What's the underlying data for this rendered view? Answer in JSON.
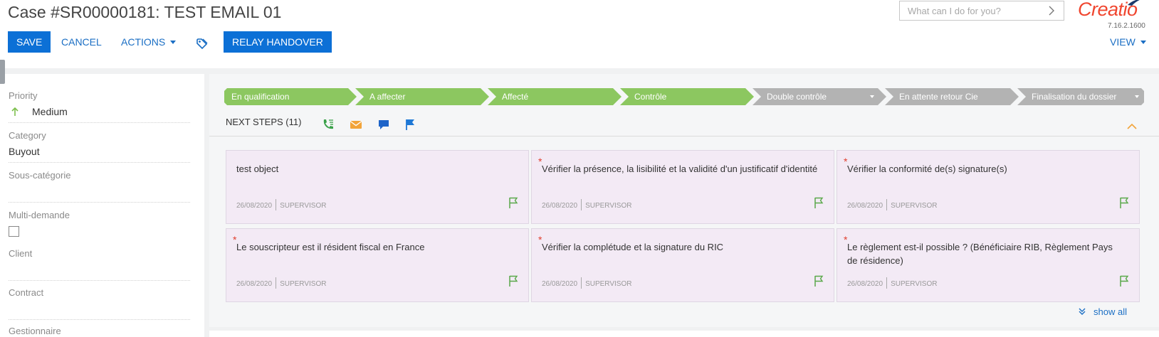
{
  "header": {
    "title": "Case #SR00000181: TEST EMAIL 01",
    "search_placeholder": "What can I do for you?",
    "logo": "Creatio",
    "version": "7.16.2.1600"
  },
  "toolbar": {
    "save": "SAVE",
    "cancel": "CANCEL",
    "actions": "ACTIONS",
    "relay": "RELAY HANDOVER",
    "view": "VIEW"
  },
  "fields": {
    "priority": {
      "label": "Priority",
      "value": "Medium"
    },
    "category": {
      "label": "Category",
      "value": "Buyout"
    },
    "subcategory": {
      "label": "Sous-catégorie",
      "value": ""
    },
    "multi": {
      "label": "Multi-demande",
      "checked": false
    },
    "client": {
      "label": "Client",
      "value": ""
    },
    "contract": {
      "label": "Contract",
      "value": ""
    },
    "gestionnaire": {
      "label": "Gestionnaire",
      "value": ""
    }
  },
  "stages": [
    {
      "label": "En qualification",
      "state": "done"
    },
    {
      "label": "A affecter",
      "state": "done"
    },
    {
      "label": "Affecté",
      "state": "done"
    },
    {
      "label": "Contrôle",
      "state": "done"
    },
    {
      "label": "Double contrôle",
      "state": "pending",
      "dropdown": true
    },
    {
      "label": "En attente retour Cie",
      "state": "pending"
    },
    {
      "label": "Finalisation du dossier",
      "state": "pending",
      "dropdown": true
    }
  ],
  "next_steps": {
    "label": "NEXT STEPS (11)",
    "show_all": "show all"
  },
  "tasks": [
    {
      "title": "test object",
      "required": false,
      "date": "26/08/2020",
      "owner": "SUPERVISOR"
    },
    {
      "title": "Vérifier la présence, la lisibilité et la validité d'un justificatif d'identité",
      "required": true,
      "date": "26/08/2020",
      "owner": "SUPERVISOR"
    },
    {
      "title": "Vérifier la conformité de(s) signature(s)",
      "required": true,
      "date": "26/08/2020",
      "owner": "SUPERVISOR"
    },
    {
      "title": "Le souscripteur est il résident fiscal en France",
      "required": true,
      "date": "26/08/2020",
      "owner": "SUPERVISOR"
    },
    {
      "title": "Vérifier la complétude et la signature du RIC",
      "required": true,
      "date": "26/08/2020",
      "owner": "SUPERVISOR"
    },
    {
      "title": "Le règlement est-il possible ? (Bénéficiaire RIB, Règlement Pays de résidence)",
      "required": true,
      "date": "26/08/2020",
      "owner": "SUPERVISOR"
    }
  ],
  "colors": {
    "primary": "#0c70d6",
    "stage_done": "#8cc760",
    "stage_pending": "#b3b3b3",
    "logo": "#f0452e",
    "task_bg": "#f3eaf5"
  }
}
